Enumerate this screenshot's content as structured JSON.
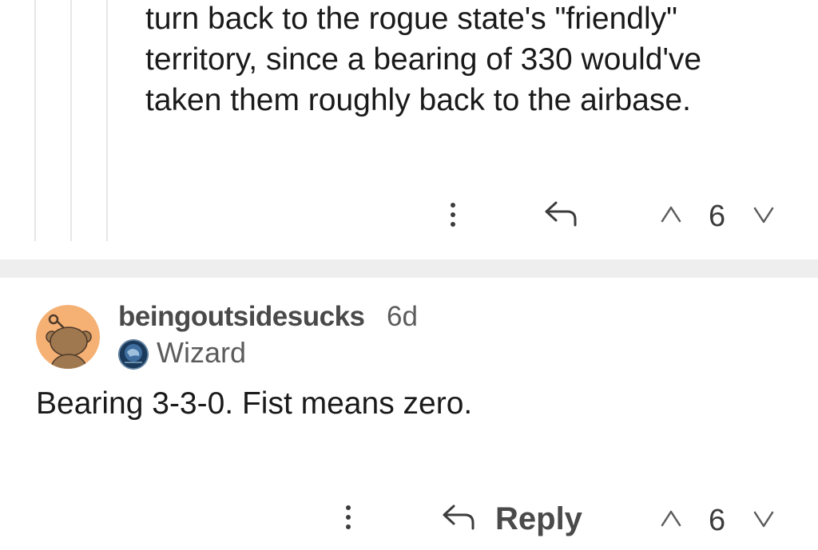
{
  "parent_comment": {
    "body_lines": [
      "turn back to the rogue state's \"friendly\"",
      "territory, since a bearing of 330 would've",
      "taken them roughly back to the airbase."
    ],
    "vote_count": "6",
    "icons": {
      "more": "more-options-icon",
      "reply": "reply-arrow-icon",
      "upvote": "upvote-icon",
      "downvote": "downvote-icon"
    }
  },
  "comment": {
    "author": "beingoutsidesucks",
    "age": "6d",
    "flair": "Wizard",
    "body": "Bearing 3-3-0. Fist means zero.",
    "reply_label": "Reply",
    "vote_count": "6",
    "avatar_color": "#f5b074",
    "icons": {
      "avatar": "snoo-avatar-icon",
      "flair": "globe-flair-icon",
      "more": "more-options-icon",
      "reply": "reply-arrow-icon",
      "upvote": "upvote-icon",
      "downvote": "downvote-icon"
    }
  }
}
